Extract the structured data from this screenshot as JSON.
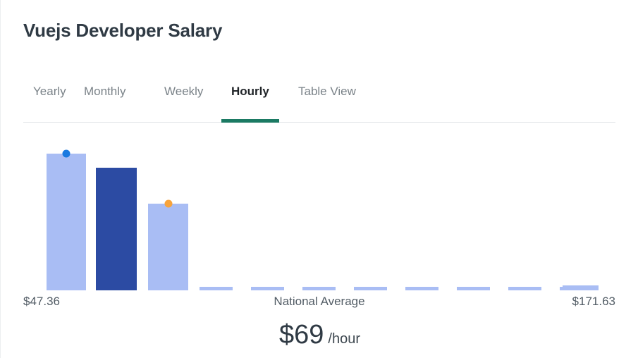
{
  "header": {
    "title": "Vuejs Developer Salary"
  },
  "tabs": {
    "items": [
      {
        "id": "yearly",
        "label": "Yearly",
        "active": false
      },
      {
        "id": "monthly",
        "label": "Monthly",
        "active": false
      },
      {
        "id": "weekly",
        "label": "Weekly",
        "active": false
      },
      {
        "id": "hourly",
        "label": "Hourly",
        "active": true
      },
      {
        "id": "table",
        "label": "Table View",
        "active": false
      }
    ],
    "active_indicator_color": "#1b7a63"
  },
  "axis": {
    "min_label": "$47.36",
    "mid_label": "National Average",
    "max_label": "$171.63"
  },
  "summary": {
    "amount": "$69",
    "unit": "/hour"
  },
  "colors": {
    "bar": "#a9bdf4",
    "bar_highlight": "#2c4ba3",
    "marker_blue": "#1a7ae0",
    "marker_orange": "#f7a33c",
    "title": "#2f3a44",
    "tab_inactive": "#7a8288",
    "tab_active": "#212529",
    "rule": "#e3e6e8"
  },
  "chart_data": {
    "type": "bar",
    "title": "Vuejs Developer Salary",
    "subtitle": "Hourly",
    "xlabel": "",
    "ylabel": "",
    "grid": false,
    "legend": "none",
    "x": [
      "$47.36",
      "",
      "",
      "",
      "",
      "",
      "",
      "",
      "",
      "",
      "",
      "$171.63"
    ],
    "categories": [
      "bin-1",
      "bin-2",
      "bin-3",
      "bin-4",
      "bin-5",
      "bin-6",
      "bin-7",
      "bin-8",
      "bin-9",
      "bin-10",
      "bin-11",
      "bin-12"
    ],
    "values": [
      194,
      174,
      123,
      5,
      5,
      5,
      5,
      5,
      5,
      5,
      5,
      7
    ],
    "ylim": [
      0,
      216
    ],
    "bar_colors": [
      "#a9bdf4",
      "#2c4ba3",
      "#a9bdf4",
      "#a9bdf4",
      "#a9bdf4",
      "#a9bdf4",
      "#a9bdf4",
      "#a9bdf4",
      "#a9bdf4",
      "#a9bdf4",
      "#a9bdf4",
      "#a9bdf4"
    ],
    "bar_left": [
      33,
      103,
      177,
      250,
      323,
      396,
      469,
      542,
      615,
      688,
      761,
      765
    ],
    "bar_width": [
      56,
      58,
      57,
      47,
      47,
      47,
      47,
      47,
      47,
      47,
      47,
      51
    ],
    "markers": [
      {
        "bin": 1,
        "color": "#1a7ae0",
        "label": ""
      },
      {
        "bin": 3,
        "color": "#f7a33c",
        "label": ""
      }
    ],
    "annotations": [
      {
        "text": "$47.36",
        "position": "axis-left"
      },
      {
        "text": "National Average",
        "position": "axis-center"
      },
      {
        "text": "$171.63",
        "position": "axis-right"
      },
      {
        "text": "$69 /hour",
        "position": "below-center"
      }
    ]
  }
}
